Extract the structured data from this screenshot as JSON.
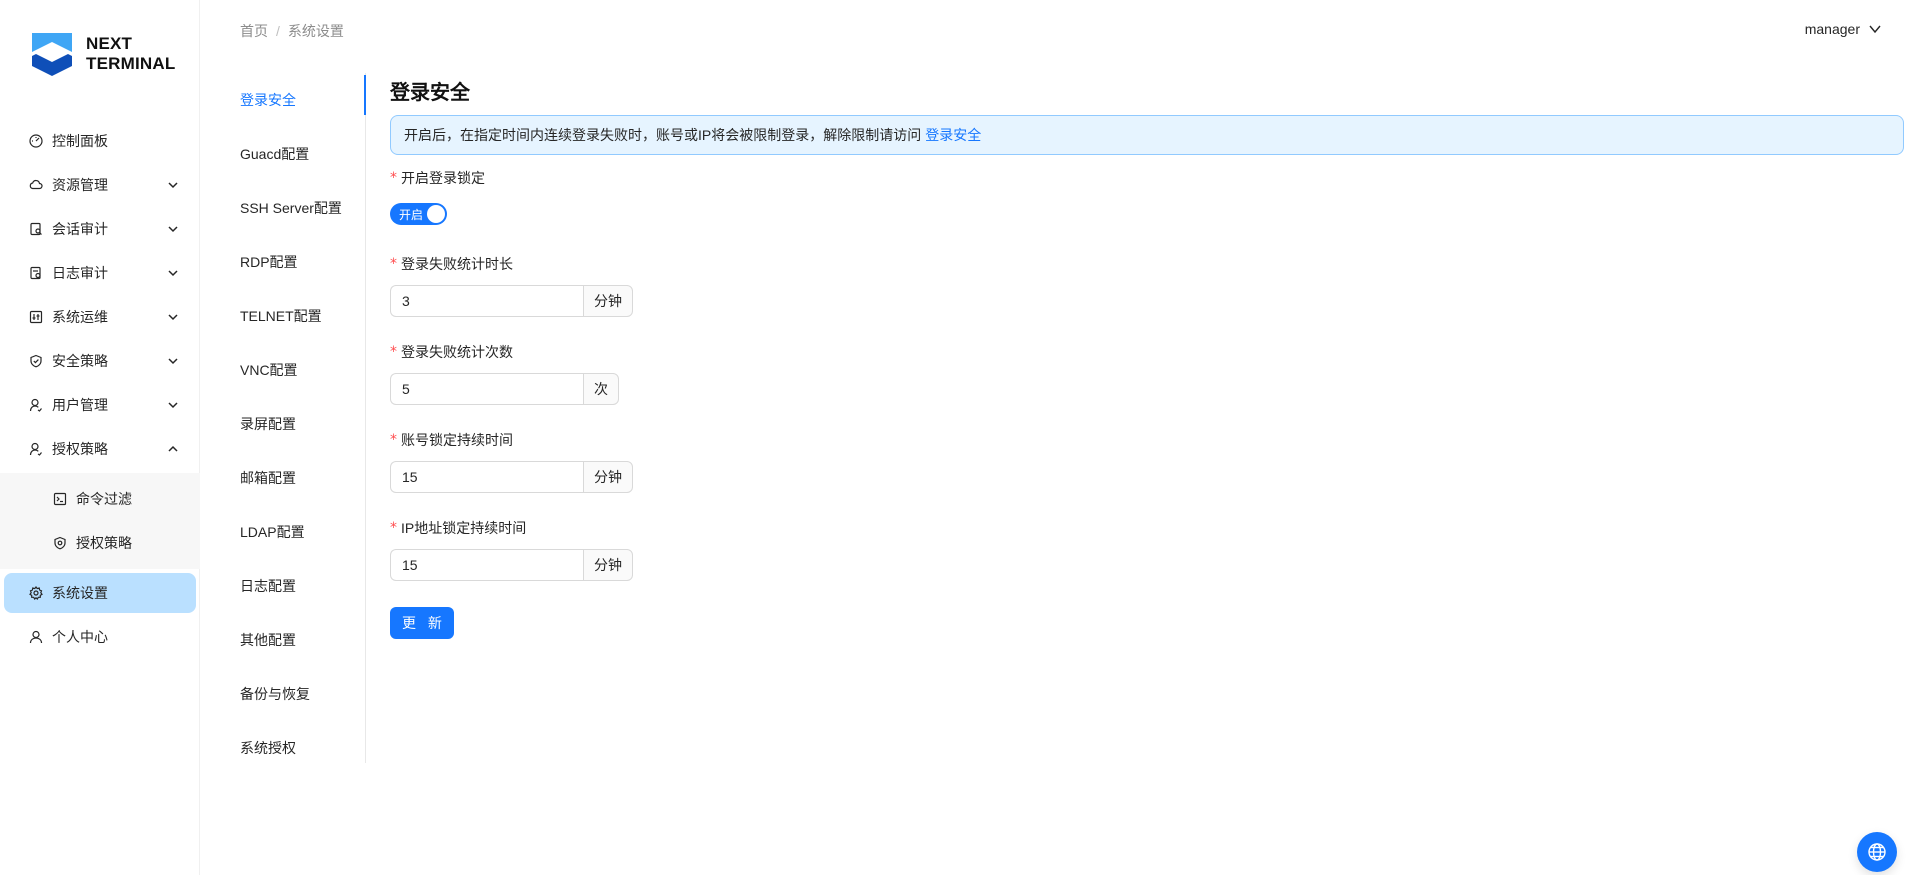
{
  "brand": {
    "line1": "NEXT",
    "line2": "TERMINAL"
  },
  "sidebar": {
    "items": [
      {
        "label": "控制面板",
        "icon": "dashboard-icon"
      },
      {
        "label": "资源管理",
        "icon": "cloud-icon",
        "expandable": true
      },
      {
        "label": "会话审计",
        "icon": "audit-icon",
        "expandable": true
      },
      {
        "label": "日志审计",
        "icon": "log-icon",
        "expandable": true
      },
      {
        "label": "系统运维",
        "icon": "ops-icon",
        "expandable": true
      },
      {
        "label": "安全策略",
        "icon": "shield-icon",
        "expandable": true
      },
      {
        "label": "用户管理",
        "icon": "user-icon",
        "expandable": true
      },
      {
        "label": "授权策略",
        "icon": "user-icon",
        "expanded": true
      },
      {
        "label": "命令过滤",
        "icon": "terminal-icon",
        "sub": true
      },
      {
        "label": "授权策略",
        "icon": "shield-icon",
        "sub": true
      },
      {
        "label": "系统设置",
        "icon": "gear-icon",
        "active": true
      },
      {
        "label": "个人中心",
        "icon": "user-icon"
      }
    ]
  },
  "header": {
    "breadcrumb": [
      "首页",
      "系统设置"
    ],
    "breadcrumb_sep": "/",
    "user": "manager"
  },
  "tabs": [
    "登录安全",
    "Guacd配置",
    "SSH Server配置",
    "RDP配置",
    "TELNET配置",
    "VNC配置",
    "录屏配置",
    "邮箱配置",
    "LDAP配置",
    "日志配置",
    "其他配置",
    "备份与恢复",
    "系统授权"
  ],
  "active_tab": "登录安全",
  "section": {
    "title": "登录安全",
    "alert_text": "开启后，在指定时间内连续登录失败时，账号或IP将会被限制登录，解除限制请访问",
    "alert_link": "登录安全",
    "lock_switch_label": "开启登录锁定",
    "switch_text": "开启",
    "switch_on": true,
    "fields": [
      {
        "label": "登录失败统计时长",
        "value": "3",
        "unit": "分钟"
      },
      {
        "label": "登录失败统计次数",
        "value": "5",
        "unit": "次"
      },
      {
        "label": "账号锁定持续时间",
        "value": "15",
        "unit": "分钟"
      },
      {
        "label": "IP地址锁定持续时间",
        "value": "15",
        "unit": "分钟"
      }
    ],
    "submit_label": "更 新"
  },
  "required_mark": "*",
  "colors": {
    "primary": "#1677ff",
    "active_bg": "#bae0ff",
    "alert_bg": "#e6f4ff",
    "alert_border": "#91caff"
  },
  "float_icon": "globe-icon"
}
